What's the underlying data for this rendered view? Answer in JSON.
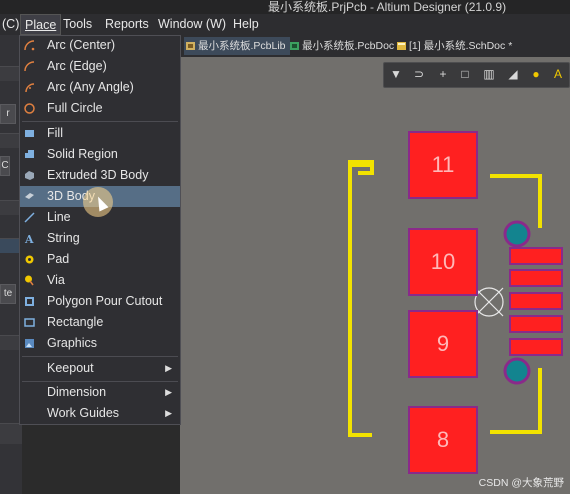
{
  "app": {
    "title": "最小系统板.PrjPcb - Altium Designer (21.0.9)"
  },
  "menubar": {
    "items": [
      {
        "label": "(C)"
      },
      {
        "label": "Place",
        "active": true
      },
      {
        "label": "Tools"
      },
      {
        "label": "Reports"
      },
      {
        "label": "Window (W)"
      },
      {
        "label": "Help"
      }
    ]
  },
  "tabs": [
    {
      "label": "最小系统板.PcbLib",
      "active": true,
      "icon": "pcblib-icon"
    },
    {
      "label": "最小系统板.PcbDoc",
      "active": false,
      "icon": "pcbdoc-icon"
    },
    {
      "label": "[1] 最小系统.SchDoc *",
      "active": false,
      "icon": "schdoc-icon"
    }
  ],
  "place_menu": {
    "items": [
      {
        "label": "Arc (Center)",
        "icon": "arc-center-icon"
      },
      {
        "label": "Arc (Edge)",
        "icon": "arc-edge-icon"
      },
      {
        "label": "Arc (Any Angle)",
        "icon": "arc-any-angle-icon"
      },
      {
        "label": "Full Circle",
        "icon": "full-circle-icon"
      },
      {
        "label": "Fill",
        "icon": "fill-icon"
      },
      {
        "label": "Solid Region",
        "icon": "solid-region-icon"
      },
      {
        "label": "Extruded 3D Body",
        "icon": "extruded-3d-body-icon"
      },
      {
        "label": "3D Body",
        "icon": "3d-body-icon",
        "highlighted": true
      },
      {
        "label": "Line",
        "icon": "line-icon"
      },
      {
        "label": "String",
        "icon": "string-icon"
      },
      {
        "label": "Pad",
        "icon": "pad-icon"
      },
      {
        "label": "Via",
        "icon": "via-icon"
      },
      {
        "label": "Polygon Pour Cutout",
        "icon": "polygon-pour-cutout-icon"
      },
      {
        "label": "Rectangle",
        "icon": "rectangle-icon"
      },
      {
        "label": "Graphics",
        "icon": "graphics-icon"
      },
      {
        "label": "Keepout",
        "submenu": true
      },
      {
        "label": "Dimension",
        "submenu": true
      },
      {
        "label": "Work Guides",
        "submenu": true
      }
    ]
  },
  "left_panel": {
    "buttons": [
      "r",
      "C",
      "C",
      "te"
    ]
  },
  "toolbar": {
    "icons": [
      "filter-icon",
      "route-icon",
      "add-icon",
      "select-rect-icon",
      "align-icon",
      "pen-icon",
      "via-place-icon",
      "text-icon"
    ]
  },
  "pads": [
    {
      "number": "11"
    },
    {
      "number": "10"
    },
    {
      "number": "9"
    },
    {
      "number": "8"
    }
  ],
  "colors": {
    "pad_fill": "#ff2020",
    "pad_border": "#8a2a8a",
    "silkscreen": "#f2e200",
    "via": "#13848f",
    "canvas": "#716f6c",
    "menu_highlight": "#566e86"
  },
  "watermark": "CSDN @大象荒野"
}
